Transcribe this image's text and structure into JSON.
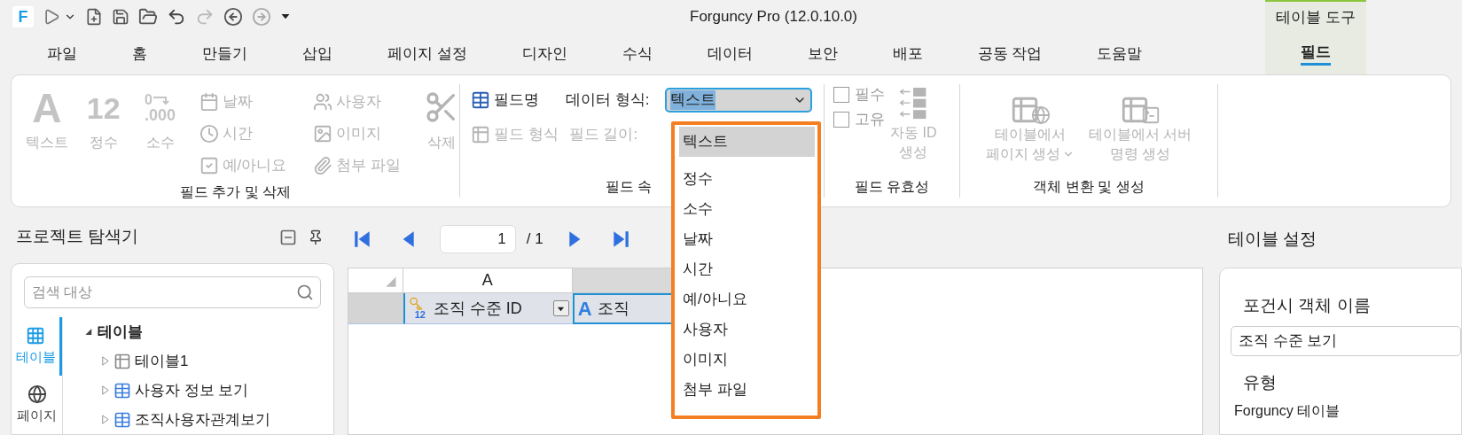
{
  "app_logo": {
    "letter": "F"
  },
  "window": {
    "title": "Forguncy Pro (12.0.10.0)"
  },
  "context_tab_group": {
    "label": "테이블 도구"
  },
  "tabs": [
    {
      "label": "파일",
      "selected": false
    },
    {
      "label": "홈",
      "selected": false
    },
    {
      "label": "만들기",
      "selected": false
    },
    {
      "label": "삽입",
      "selected": false
    },
    {
      "label": "페이지 설정",
      "selected": false
    },
    {
      "label": "디자인",
      "selected": false
    },
    {
      "label": "수식",
      "selected": false
    },
    {
      "label": "데이터",
      "selected": false
    },
    {
      "label": "보안",
      "selected": false
    },
    {
      "label": "배포",
      "selected": false
    },
    {
      "label": "공동 작업",
      "selected": false
    },
    {
      "label": "도움말",
      "selected": false
    },
    {
      "label": "필드",
      "selected": true
    }
  ],
  "add_delete_group": {
    "label": "필드 추가 및 삭제",
    "large_buttons": [
      {
        "kind": "text",
        "glyph": [
          "A"
        ],
        "label": "텍스트",
        "disabled": true
      },
      {
        "kind": "integer",
        "glyph": [
          "12"
        ],
        "label": "정수",
        "disabled": true
      },
      {
        "kind": "decimal",
        "glyph": [
          "0",
          ".000"
        ],
        "label": "소수",
        "disabled": true
      }
    ],
    "small_buttons": [
      {
        "kind": "date",
        "label": "날짜",
        "disabled": true
      },
      {
        "kind": "time",
        "label": "시간",
        "disabled": true
      },
      {
        "kind": "boolean",
        "label": "예/아니요",
        "disabled": true
      },
      {
        "kind": "user",
        "label": "사용자",
        "disabled": true
      },
      {
        "kind": "image",
        "label": "이미지",
        "disabled": true
      },
      {
        "kind": "attachment",
        "label": "첨부 파일",
        "disabled": true
      }
    ],
    "delete_button": {
      "label": "삭제",
      "disabled": true
    }
  },
  "properties_group": {
    "label": "필드 속",
    "field_name_button": {
      "label": "필드명",
      "disabled": false
    },
    "data_type_label": "데이터 형식:",
    "data_type_value": "텍스트",
    "field_format_button": {
      "label": "필드 형식",
      "disabled": true
    },
    "field_length_label": {
      "label": "필드 길이:",
      "disabled": true
    }
  },
  "validity_group": {
    "label": "필드 유효성",
    "checkboxes": [
      {
        "label": "필수",
        "checked": false
      },
      {
        "label": "고유",
        "checked": false
      }
    ],
    "auto_id_button": {
      "label_lines": [
        "자동 ID",
        "생성"
      ],
      "disabled": true
    }
  },
  "object_group": {
    "label": "객체 변환 및 생성",
    "buttons": [
      {
        "kind": "page",
        "label_lines": [
          "테이블에서",
          "페이지 생성"
        ],
        "has_menu": true,
        "disabled": true
      },
      {
        "kind": "server",
        "label_lines": [
          "테이블에서 서버",
          "명령 생성"
        ],
        "has_menu": false,
        "disabled": true
      }
    ]
  },
  "data_type_dropdown": {
    "items": [
      {
        "label": "텍스트",
        "selected": true
      },
      {
        "label": "정수",
        "selected": false
      },
      {
        "label": "소수",
        "selected": false
      },
      {
        "label": "날짜",
        "selected": false
      },
      {
        "label": "시간",
        "selected": false
      },
      {
        "label": "예/아니요",
        "selected": false
      },
      {
        "label": "사용자",
        "selected": false
      },
      {
        "label": "이미지",
        "selected": false
      },
      {
        "label": "첨부 파일",
        "selected": false
      }
    ]
  },
  "explorer": {
    "title": "프로젝트 탐색기",
    "search": {
      "placeholder": "검색 대상"
    },
    "side_tabs": [
      {
        "kind": "table",
        "label": "테이블",
        "selected": true
      },
      {
        "kind": "page",
        "label": "페이지",
        "selected": false
      }
    ],
    "tree": [
      {
        "label": "테이블",
        "kind": "root",
        "expanded": true,
        "children": [
          {
            "label": "테이블1",
            "kind": "table",
            "expanded": false
          },
          {
            "label": "사용자 정보 보기",
            "kind": "view",
            "expanded": false
          },
          {
            "label": "조직사용자관계보기",
            "kind": "view",
            "expanded": false
          }
        ]
      }
    ]
  },
  "pager": {
    "page": "1",
    "total": "/ 1"
  },
  "grid": {
    "columns": [
      "A"
    ],
    "fields": [
      {
        "kind": "key",
        "badge": "12",
        "label": "조직 수준 ID",
        "filter": true,
        "selected": false
      },
      {
        "kind": "text",
        "badge": "A",
        "label": "조직",
        "filter": false,
        "selected": true
      }
    ]
  },
  "settings": {
    "title": "테이블 설정",
    "name_label": "포건시 객체 이름",
    "name_value": "조직 수준 보기",
    "type_label": "유형",
    "type_value": "Forguncy 테이블"
  }
}
